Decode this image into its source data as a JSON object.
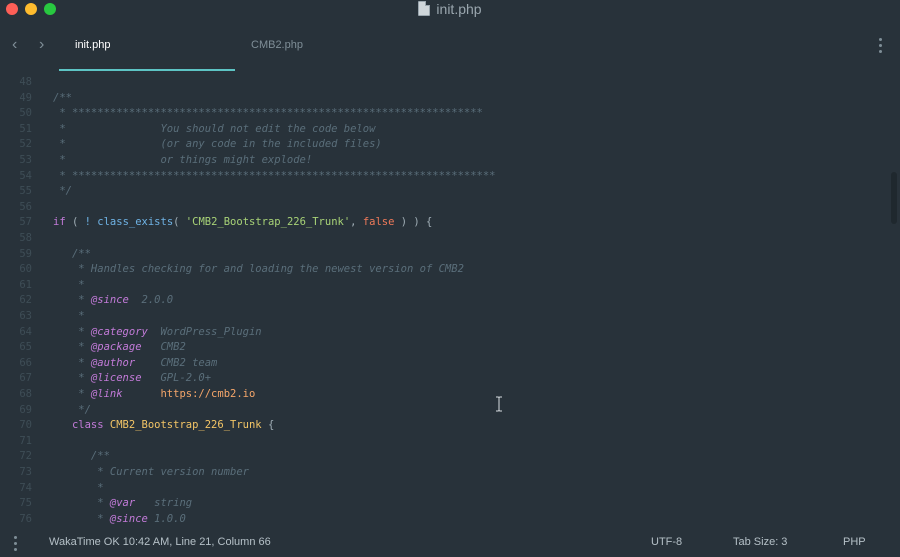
{
  "window": {
    "title": "init.php"
  },
  "tabs": [
    {
      "label": "init.php",
      "active": true
    },
    {
      "label": "CMB2.php",
      "active": false
    }
  ],
  "editor": {
    "lines": [
      {
        "n": "48",
        "tokens": []
      },
      {
        "n": "49",
        "tokens": [
          {
            "t": "/**",
            "c": "comment"
          }
        ]
      },
      {
        "n": "50",
        "tokens": [
          {
            "t": " * *****************************************************************",
            "c": "comment"
          }
        ]
      },
      {
        "n": "51",
        "tokens": [
          {
            "t": " *               You should not edit the code below",
            "c": "comment"
          }
        ]
      },
      {
        "n": "52",
        "tokens": [
          {
            "t": " *               (or any code in the included files)",
            "c": "comment"
          }
        ]
      },
      {
        "n": "53",
        "tokens": [
          {
            "t": " *               or things might explode!",
            "c": "comment"
          }
        ]
      },
      {
        "n": "54",
        "tokens": [
          {
            "t": " * *******************************************************************",
            "c": "comment"
          }
        ]
      },
      {
        "n": "55",
        "tokens": [
          {
            "t": " */",
            "c": "comment"
          }
        ]
      },
      {
        "n": "56",
        "tokens": []
      },
      {
        "n": "57",
        "tokens": [
          {
            "t": "if",
            "c": "kw"
          },
          {
            "t": " ( ",
            "c": "punc"
          },
          {
            "t": "!",
            "c": "fn"
          },
          {
            "t": " ",
            "c": "punc"
          },
          {
            "t": "class_exists",
            "c": "fn"
          },
          {
            "t": "( ",
            "c": "punc"
          },
          {
            "t": "'CMB2_Bootstrap_226_Trunk'",
            "c": "str"
          },
          {
            "t": ", ",
            "c": "punc"
          },
          {
            "t": "false",
            "c": "bool"
          },
          {
            "t": " ) ) {",
            "c": "punc"
          }
        ]
      },
      {
        "n": "58",
        "tokens": []
      },
      {
        "n": "59",
        "tokens": [
          {
            "t": "   /**",
            "c": "comment"
          }
        ]
      },
      {
        "n": "60",
        "tokens": [
          {
            "t": "    * Handles checking for and loading the newest version of CMB2",
            "c": "comment"
          }
        ]
      },
      {
        "n": "61",
        "tokens": [
          {
            "t": "    *",
            "c": "comment"
          }
        ]
      },
      {
        "n": "62",
        "tokens": [
          {
            "t": "    * ",
            "c": "comment"
          },
          {
            "t": "@since",
            "c": "tag"
          },
          {
            "t": "  2.0.0",
            "c": "comment"
          }
        ]
      },
      {
        "n": "63",
        "tokens": [
          {
            "t": "    *",
            "c": "comment"
          }
        ]
      },
      {
        "n": "64",
        "tokens": [
          {
            "t": "    * ",
            "c": "comment"
          },
          {
            "t": "@category",
            "c": "tag"
          },
          {
            "t": "  WordPress_Plugin",
            "c": "comment"
          }
        ]
      },
      {
        "n": "65",
        "tokens": [
          {
            "t": "    * ",
            "c": "comment"
          },
          {
            "t": "@package",
            "c": "tag"
          },
          {
            "t": "   CMB2",
            "c": "comment"
          }
        ]
      },
      {
        "n": "66",
        "tokens": [
          {
            "t": "    * ",
            "c": "comment"
          },
          {
            "t": "@author",
            "c": "tag"
          },
          {
            "t": "    CMB2 team",
            "c": "comment"
          }
        ]
      },
      {
        "n": "67",
        "tokens": [
          {
            "t": "    * ",
            "c": "comment"
          },
          {
            "t": "@license",
            "c": "tag"
          },
          {
            "t": "   GPL-2.0+",
            "c": "comment"
          }
        ]
      },
      {
        "n": "68",
        "tokens": [
          {
            "t": "    * ",
            "c": "comment"
          },
          {
            "t": "@link",
            "c": "tag"
          },
          {
            "t": "      ",
            "c": "comment"
          },
          {
            "t": "https://cmb2.io",
            "c": "url"
          }
        ]
      },
      {
        "n": "69",
        "tokens": [
          {
            "t": "    */",
            "c": "comment"
          }
        ]
      },
      {
        "n": "70",
        "tokens": [
          {
            "t": "   class",
            "c": "kw"
          },
          {
            "t": " ",
            "c": "punc"
          },
          {
            "t": "CMB2_Bootstrap_226_Trunk",
            "c": "cls"
          },
          {
            "t": " {",
            "c": "punc"
          }
        ]
      },
      {
        "n": "71",
        "tokens": []
      },
      {
        "n": "72",
        "tokens": [
          {
            "t": "      /**",
            "c": "comment"
          }
        ]
      },
      {
        "n": "73",
        "tokens": [
          {
            "t": "       * Current version number",
            "c": "comment"
          }
        ]
      },
      {
        "n": "74",
        "tokens": [
          {
            "t": "       *",
            "c": "comment"
          }
        ]
      },
      {
        "n": "75",
        "tokens": [
          {
            "t": "       * ",
            "c": "comment"
          },
          {
            "t": "@var",
            "c": "tag"
          },
          {
            "t": "   string",
            "c": "comment"
          }
        ]
      },
      {
        "n": "76",
        "tokens": [
          {
            "t": "       * ",
            "c": "comment"
          },
          {
            "t": "@since",
            "c": "tag"
          },
          {
            "t": " 1.0.0",
            "c": "comment"
          }
        ]
      }
    ]
  },
  "statusbar": {
    "left": "WakaTime OK 10:42 AM, Line 21, Column 66",
    "encoding": "UTF-8",
    "tab_size": "Tab Size: 3",
    "language": "PHP"
  }
}
